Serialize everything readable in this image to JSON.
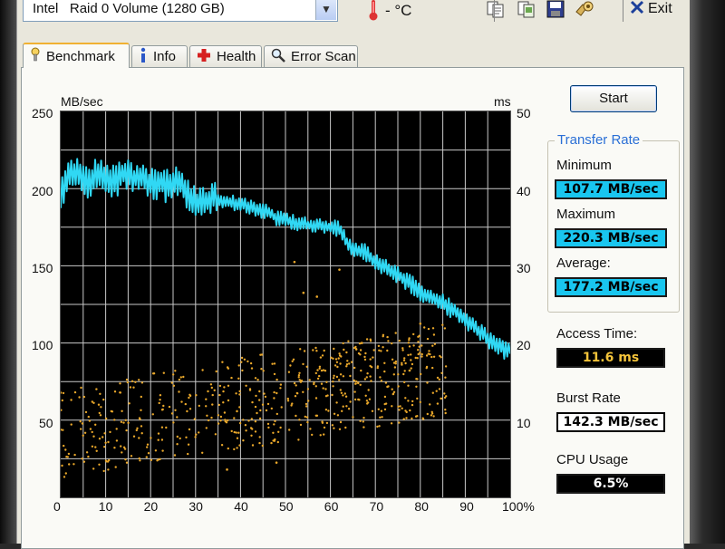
{
  "toolbar": {
    "drive_prefix": "Intel",
    "drive_name": "Raid 0 Volume (1280 GB)",
    "temperature": "- °C",
    "exit_label": "Exit",
    "icons": [
      "copy-text-icon",
      "copy-screenshot-icon",
      "save-icon",
      "options-icon",
      "exit-icon"
    ]
  },
  "tabs": [
    {
      "label": "Benchmark",
      "icon": "benchmark-icon",
      "active": true
    },
    {
      "label": "Info",
      "icon": "info-icon",
      "active": false
    },
    {
      "label": "Health",
      "icon": "health-icon",
      "active": false
    },
    {
      "label": "Error Scan",
      "icon": "error-scan-icon",
      "active": false
    }
  ],
  "benchmark": {
    "start_label": "Start",
    "transfer_rate_title": "Transfer Rate",
    "minimum_label": "Minimum",
    "minimum_value": "107.7 MB/sec",
    "maximum_label": "Maximum",
    "maximum_value": "220.3 MB/sec",
    "average_label": "Average:",
    "average_value": "177.2 MB/sec",
    "access_time_label": "Access Time:",
    "access_time_value": "11.6 ms",
    "burst_rate_label": "Burst Rate",
    "burst_rate_value": "142.3 MB/sec",
    "cpu_usage_label": "CPU Usage",
    "cpu_usage_value": "6.5%"
  },
  "colors": {
    "transfer_line": "#30d8f4",
    "access_dots": "#e9a72a",
    "grid": "#c9c9c9",
    "plot_bg": "#000000",
    "tab_highlight": "#f0b132",
    "group_title": "#2a6fd6"
  },
  "chart_data": {
    "type": "line",
    "xlabel": "",
    "ylabel_left": "MB/sec",
    "ylabel_right": "ms",
    "x_ticks": [
      "0",
      "10",
      "20",
      "30",
      "40",
      "50",
      "60",
      "70",
      "80",
      "90",
      "100%"
    ],
    "y_ticks_left": [
      "50",
      "100",
      "150",
      "200",
      "250"
    ],
    "y_ticks_right": [
      "10",
      "20",
      "30",
      "40",
      "50"
    ],
    "x_range": [
      0,
      100
    ],
    "y_range_left": [
      0,
      250
    ],
    "y_range_right": [
      0,
      50
    ],
    "grid": true,
    "series": [
      {
        "name": "",
        "axis": "left",
        "x": [
          0,
          2,
          4,
          6,
          8,
          10,
          12,
          14,
          16,
          18,
          20,
          22,
          24,
          26,
          28,
          30,
          32,
          34,
          36,
          38,
          40,
          42,
          44,
          46,
          48,
          50,
          52,
          54,
          56,
          58,
          60,
          62,
          64,
          66,
          68,
          70,
          72,
          74,
          76,
          78,
          80,
          82,
          84,
          86,
          88,
          90,
          92,
          94,
          96,
          98,
          100
        ],
        "values": [
          195,
          208,
          212,
          203,
          210,
          207,
          204,
          210,
          206,
          209,
          202,
          204,
          201,
          205,
          198,
          192,
          190,
          194,
          192,
          191,
          190,
          188,
          186,
          185,
          181,
          180,
          178,
          177,
          176,
          176,
          175,
          174,
          163,
          160,
          158,
          152,
          149,
          146,
          142,
          138,
          133,
          130,
          128,
          124,
          120,
          115,
          110,
          106,
          100,
          97,
          93
        ]
      },
      {
        "name": "",
        "axis": "right",
        "style": "scatter",
        "x_range": [
          0,
          100
        ],
        "y_range_ms": [
          1,
          23
        ],
        "trend_ms_start": 8.5,
        "trend_ms_end": 16.5
      }
    ]
  }
}
